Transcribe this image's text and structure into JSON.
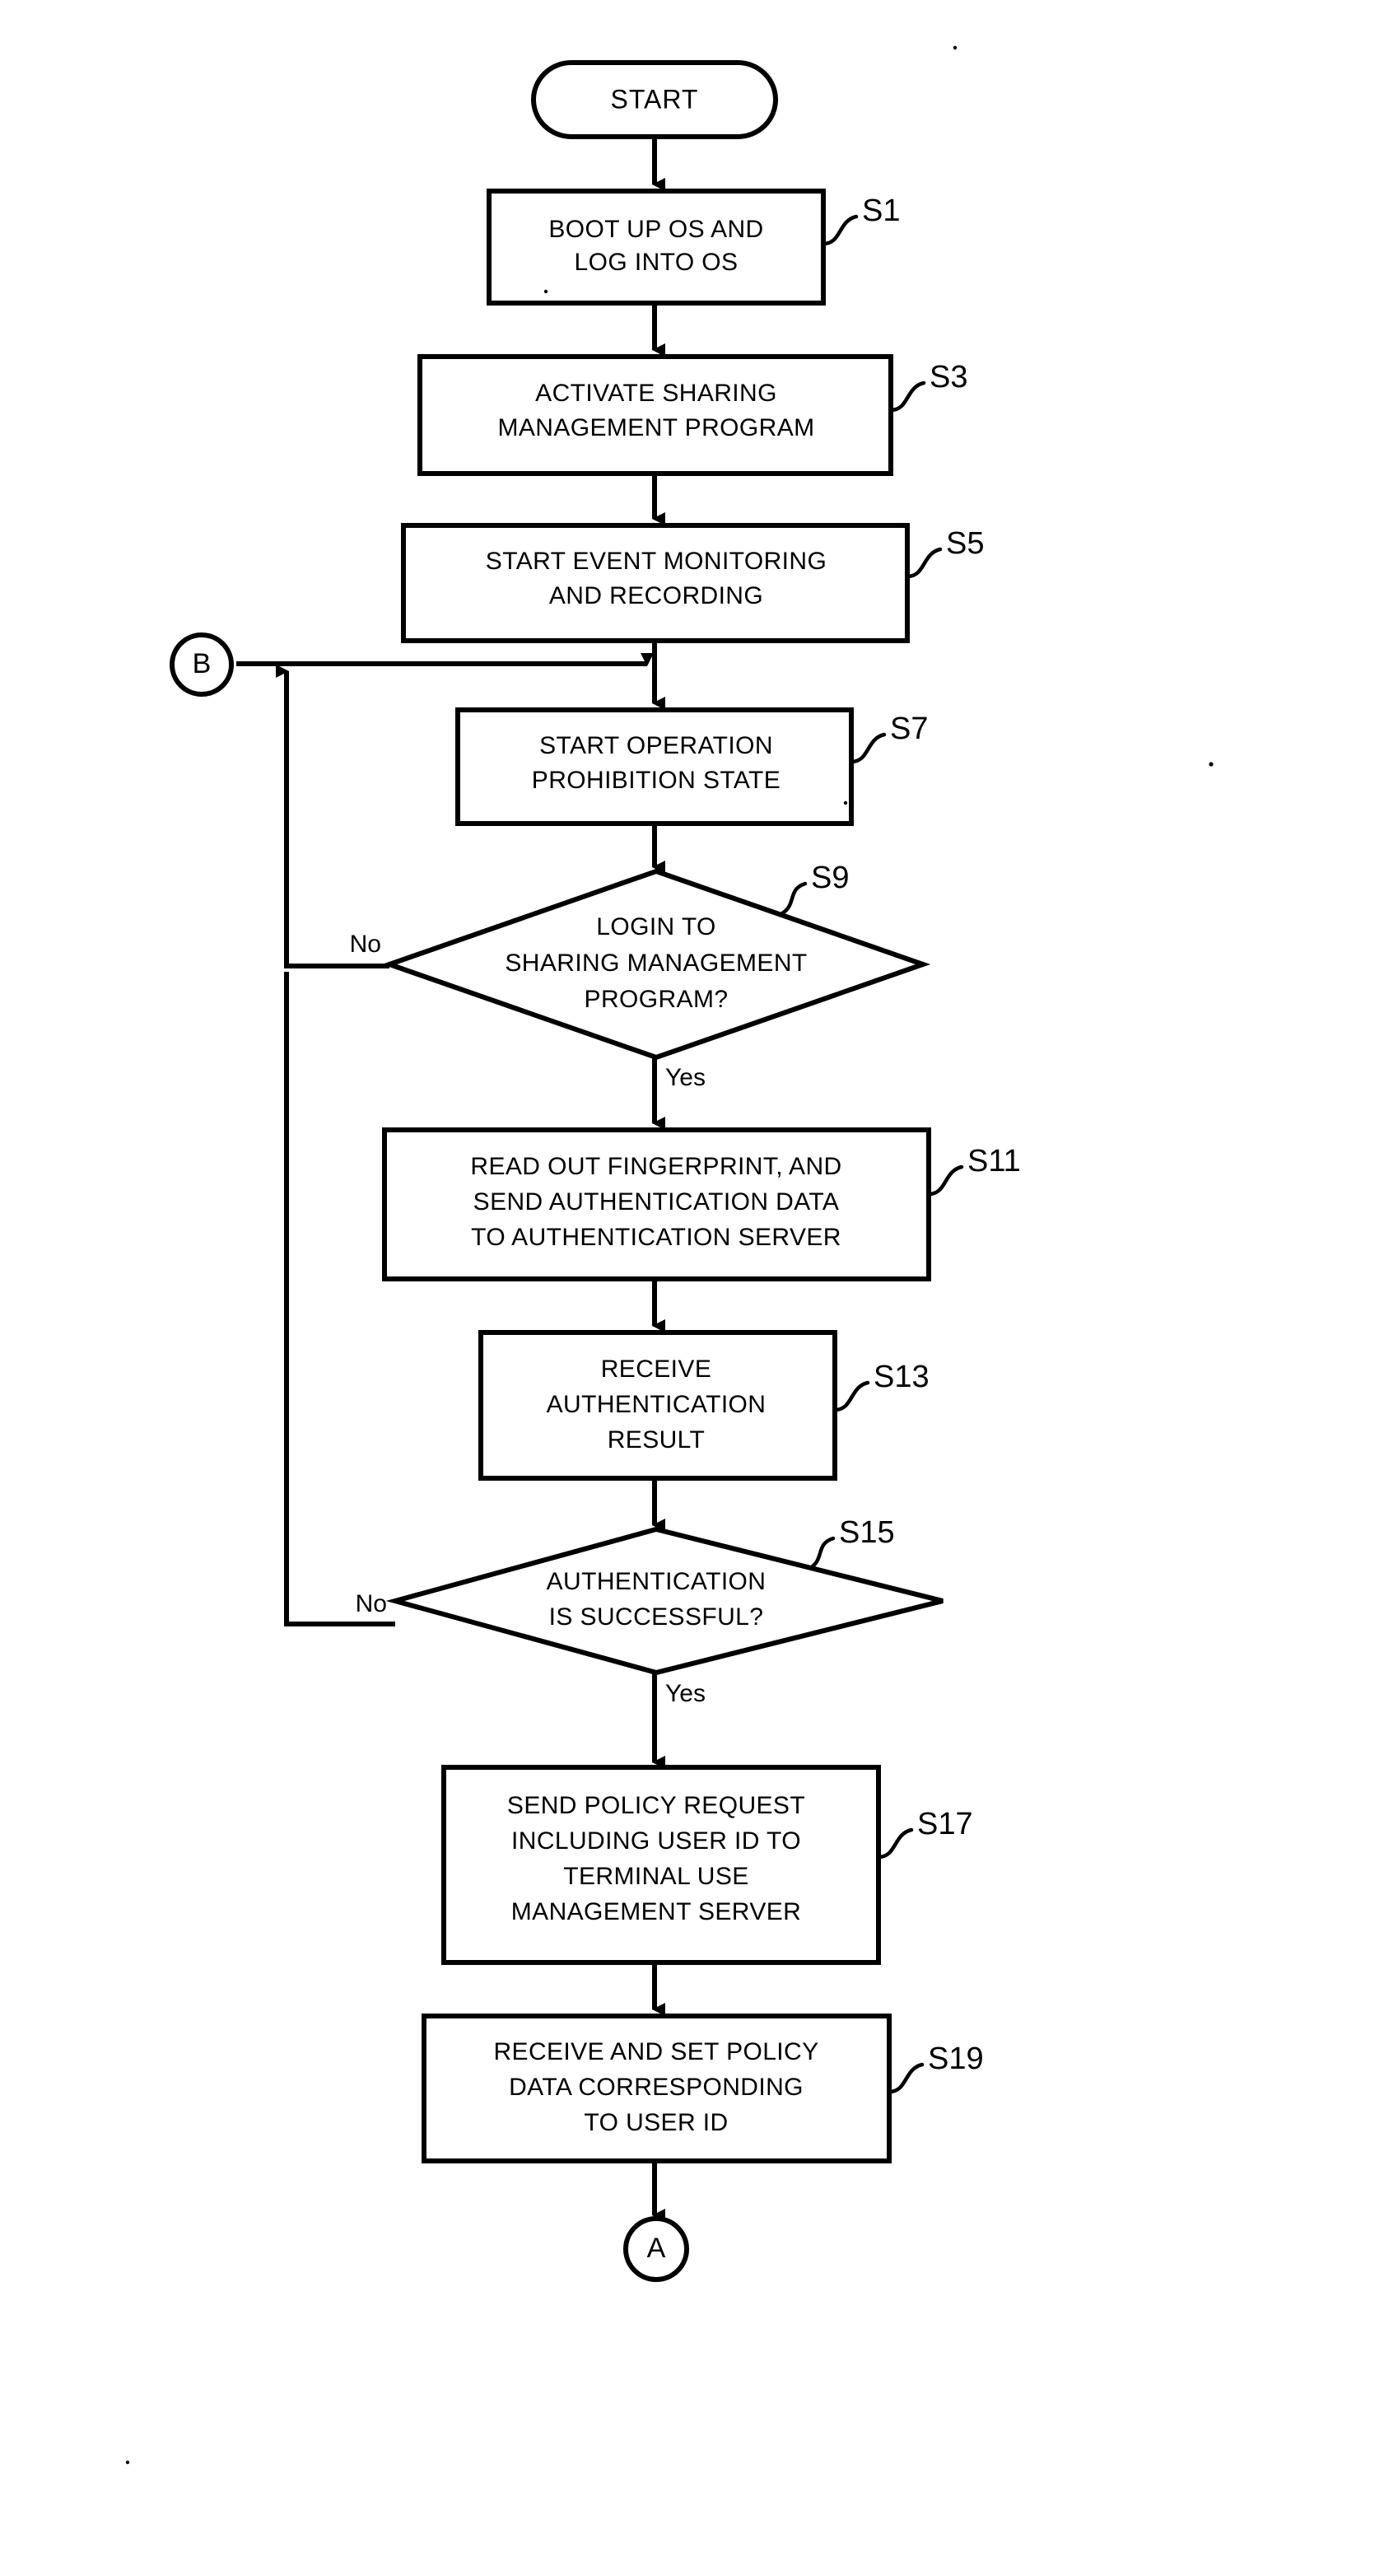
{
  "diagram": {
    "type": "flowchart",
    "orientation": "vertical",
    "title_visible": false,
    "background_color": "#ffffff",
    "stroke_color": "#000000"
  },
  "nodes": {
    "start": {
      "shape": "stadium",
      "label": "START"
    },
    "s1": {
      "shape": "process",
      "ref": "S1",
      "lines": [
        "BOOT UP OS AND",
        "LOG INTO OS"
      ]
    },
    "s3": {
      "shape": "process",
      "ref": "S3",
      "lines": [
        "ACTIVATE SHARING",
        "MANAGEMENT PROGRAM"
      ]
    },
    "s5": {
      "shape": "process",
      "ref": "S5",
      "lines": [
        "START EVENT MONITORING",
        "AND RECORDING"
      ]
    },
    "s7": {
      "shape": "process",
      "ref": "S7",
      "lines": [
        "START OPERATION",
        "PROHIBITION STATE"
      ]
    },
    "s9": {
      "shape": "decision",
      "ref": "S9",
      "lines": [
        "LOGIN TO",
        "SHARING MANAGEMENT",
        "PROGRAM?"
      ],
      "branch_no": "No",
      "branch_yes": "Yes"
    },
    "s11": {
      "shape": "process",
      "ref": "S11",
      "lines": [
        "READ OUT FINGERPRINT, AND",
        "SEND AUTHENTICATION DATA",
        "TO AUTHENTICATION SERVER"
      ]
    },
    "s13": {
      "shape": "process",
      "ref": "S13",
      "lines": [
        "RECEIVE",
        "AUTHENTICATION",
        "RESULT"
      ]
    },
    "s15": {
      "shape": "decision",
      "ref": "S15",
      "lines": [
        "AUTHENTICATION",
        "IS SUCCESSFUL?"
      ],
      "branch_no": "No",
      "branch_yes": "Yes"
    },
    "s17": {
      "shape": "process",
      "ref": "S17",
      "lines": [
        "SEND POLICY REQUEST",
        "INCLUDING USER ID TO",
        "TERMINAL USE",
        "MANAGEMENT SERVER"
      ]
    },
    "s19": {
      "shape": "process",
      "ref": "S19",
      "lines": [
        "RECEIVE AND SET POLICY",
        "DATA CORRESPONDING",
        "TO USER ID"
      ]
    },
    "connector_b": {
      "shape": "circle",
      "label": "B"
    },
    "connector_a": {
      "shape": "circle",
      "label": "A"
    }
  },
  "edges": [
    {
      "from": "start",
      "to": "s1",
      "label": ""
    },
    {
      "from": "s1",
      "to": "s3",
      "label": ""
    },
    {
      "from": "s3",
      "to": "s5",
      "label": ""
    },
    {
      "from": "s5",
      "to": "s7",
      "label": ""
    },
    {
      "from": "connector_b",
      "to": "s7",
      "label": ""
    },
    {
      "from": "s7",
      "to": "s9",
      "label": ""
    },
    {
      "from": "s9",
      "to": "s11",
      "label": "Yes"
    },
    {
      "from": "s9",
      "to": "connector_b",
      "label": "No"
    },
    {
      "from": "s11",
      "to": "s13",
      "label": ""
    },
    {
      "from": "s13",
      "to": "s15",
      "label": ""
    },
    {
      "from": "s15",
      "to": "s17",
      "label": "Yes"
    },
    {
      "from": "s15",
      "to": "s9_no_junction",
      "label": "No"
    },
    {
      "from": "s17",
      "to": "s19",
      "label": ""
    },
    {
      "from": "s19",
      "to": "connector_a",
      "label": ""
    }
  ]
}
